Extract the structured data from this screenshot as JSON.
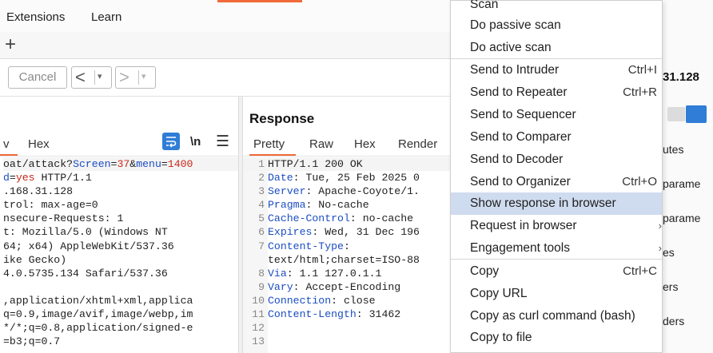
{
  "menubar": {
    "items": [
      "Extensions",
      "Learn"
    ]
  },
  "tabbar": {
    "add_label": "+"
  },
  "toolbar": {
    "cancel_label": "Cancel",
    "back_label": "<",
    "forward_label": ">",
    "dropdown_glyph": "▾"
  },
  "request": {
    "tabs": {
      "raw_tail": "v",
      "hex": "Hex"
    },
    "newline_label": "\\n",
    "menu_glyph": "☰",
    "lines": [
      {
        "a": "oat/attack?",
        "b": "Screen",
        "c": "=",
        "d": "37",
        "e": "&",
        "f": "menu",
        "g": "=",
        "h": "1400"
      },
      {
        "a": "d",
        "b": "=",
        "c": "yes",
        "d": " HTTP/1.1"
      },
      ".168.31.128",
      "trol: max-age=0",
      "nsecure-Requests: 1",
      "t: Mozilla/5.0 (Windows NT",
      "64; x64) AppleWebKit/537.36",
      "ike Gecko)",
      "4.0.5735.134 Safari/537.36",
      "",
      ",application/xhtml+xml,applica",
      "q=0.9,image/avif,image/webp,im",
      "*/*;q=0.8,application/signed-e",
      "=b3;q=0.7"
    ]
  },
  "response": {
    "title": "Response",
    "tabs": {
      "pretty": "Pretty",
      "raw": "Raw",
      "hex": "Hex",
      "render": "Render"
    },
    "lines": [
      {
        "n": "1",
        "k": "",
        "v": "HTTP/1.1 200 OK"
      },
      {
        "n": "2",
        "k": "Date",
        "v": ": Tue, 25 Feb 2025 0"
      },
      {
        "n": "3",
        "k": "Server",
        "v": ": Apache-Coyote/1."
      },
      {
        "n": "4",
        "k": "Pragma",
        "v": ": No-cache"
      },
      {
        "n": "5",
        "k": "Cache-Control",
        "v": ": no-cache"
      },
      {
        "n": "6",
        "k": "Expires",
        "v": ": Wed, 31 Dec 196"
      },
      {
        "n": "7",
        "k": "Content-Type",
        "v": ":"
      },
      {
        "n": "",
        "k": "",
        "v": "text/html;charset=ISO-88"
      },
      {
        "n": "8",
        "k": "Via",
        "v": ": 1.1 127.0.1.1"
      },
      {
        "n": "9",
        "k": "Vary",
        "v": ": Accept-Encoding"
      },
      {
        "n": "10",
        "k": "Connection",
        "v": ": close"
      },
      {
        "n": "11",
        "k": "Content-Length",
        "v": ": 31462"
      },
      {
        "n": "12",
        "k": "",
        "v": ""
      },
      {
        "n": "13",
        "k": "",
        "v": ""
      }
    ]
  },
  "right_panel": {
    "target_ip": "31.128",
    "items": [
      "utes",
      "parame",
      "parame",
      "es",
      "ers",
      "ders"
    ]
  },
  "context_menu": {
    "items": [
      {
        "label": "Scan",
        "shortcut": ""
      },
      {
        "label": "Do passive scan",
        "shortcut": ""
      },
      {
        "label": "Do active scan",
        "shortcut": ""
      },
      {
        "label": "Send to Intruder",
        "shortcut": "Ctrl+I"
      },
      {
        "label": "Send to Repeater",
        "shortcut": "Ctrl+R"
      },
      {
        "label": "Send to Sequencer",
        "shortcut": ""
      },
      {
        "label": "Send to Comparer",
        "shortcut": ""
      },
      {
        "label": "Send to Decoder",
        "shortcut": ""
      },
      {
        "label": "Send to Organizer",
        "shortcut": "Ctrl+O"
      },
      {
        "label": "Show response in browser",
        "shortcut": ""
      },
      {
        "label": "Request in browser",
        "shortcut": ""
      },
      {
        "label": "Engagement tools",
        "shortcut": ""
      },
      {
        "label": "Copy",
        "shortcut": "Ctrl+C"
      },
      {
        "label": "Copy URL",
        "shortcut": ""
      },
      {
        "label": "Copy as curl command (bash)",
        "shortcut": ""
      },
      {
        "label": "Copy to file",
        "shortcut": ""
      }
    ],
    "submenu_glyph": "›"
  },
  "colors": {
    "accent": "#f06a3a",
    "blue": "#2f7dd6",
    "hover": "#cfdcef",
    "key": "#1b4dc2",
    "param_value": "#c6281c"
  }
}
